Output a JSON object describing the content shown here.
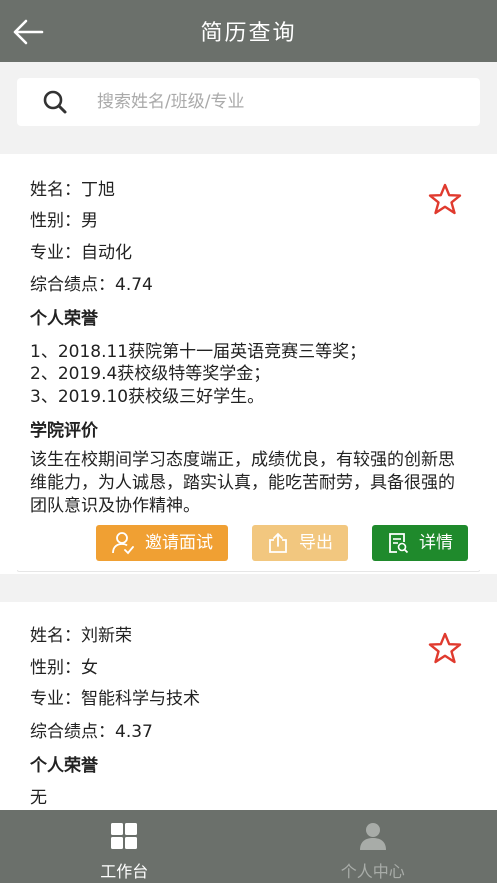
{
  "header": {
    "title": "简历查询"
  },
  "search": {
    "placeholder": "搜索姓名/班级/专业"
  },
  "candidates": [
    {
      "name_label": "姓名：",
      "name": "丁旭",
      "gender_label": "性别：",
      "gender": "男",
      "major_label": "专业：",
      "major": "自动化",
      "gpa_label": "综合绩点：",
      "gpa": "4.74",
      "honors_title": "个人荣誉",
      "honors": [
        "1、2018.11获院第十一届英语竞赛三等奖；",
        "2、2019.4获校级特等奖学金；",
        "3、2019.10获校级三好学生。"
      ],
      "evaluation_title": "学院评价",
      "evaluation": "该生在校期间学习态度端正，成绩优良，有较强的创新思维能力，为人诚恳，踏实认真，能吃苦耐劳，具备很强的团队意识及协作精神。",
      "buttons": {
        "invite": "邀请面试",
        "export": "导出",
        "detail": "详情"
      }
    },
    {
      "name_label": "姓名：",
      "name": "刘新荣",
      "gender_label": "性别：",
      "gender": "女",
      "major_label": "专业：",
      "major": "智能科学与技术",
      "gpa_label": "综合绩点：",
      "gpa": "4.37",
      "honors_title": "个人荣誉",
      "honors": [
        "无"
      ]
    }
  ],
  "tabbar": {
    "items": [
      {
        "label": "工作台",
        "icon": "grid-icon",
        "active": true
      },
      {
        "label": "个人中心",
        "icon": "person-icon",
        "active": false
      }
    ]
  },
  "colors": {
    "header_bg": "#6b706b",
    "star": "#e03a2e",
    "invite_btn": "#f0a033",
    "export_btn": "#f2c77f",
    "detail_btn": "#1f8a2c"
  }
}
